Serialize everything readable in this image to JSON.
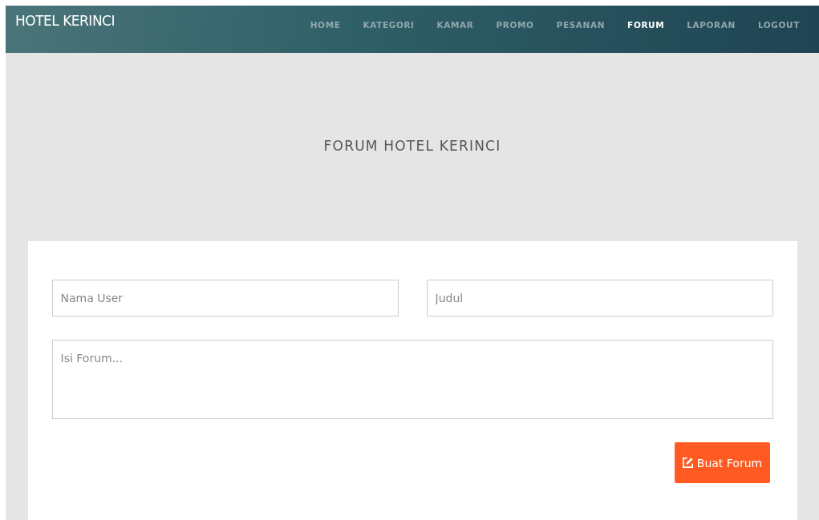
{
  "brand": "HOTEL KERINCI",
  "nav": [
    {
      "label": "HOME",
      "selected": false
    },
    {
      "label": "KATEGORI",
      "selected": false
    },
    {
      "label": "KAMAR",
      "selected": false
    },
    {
      "label": "PROMO",
      "selected": false
    },
    {
      "label": "PESANAN",
      "selected": false
    },
    {
      "label": "FORUM",
      "selected": true
    },
    {
      "label": "LAPORAN",
      "selected": false
    },
    {
      "label": "LOGOUT",
      "selected": false
    }
  ],
  "heading": "FORUM HOTEL KERINCI",
  "form": {
    "name_field": {
      "placeholder": "Nama User"
    },
    "title_field": {
      "placeholder": "Judul"
    },
    "body_field": {
      "placeholder": "Isi Forum..."
    },
    "submit": "Buat Forum"
  }
}
